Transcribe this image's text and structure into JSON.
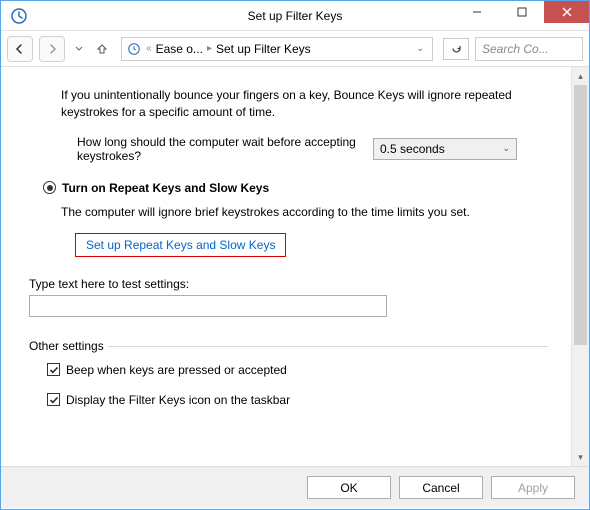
{
  "titlebar": {
    "title": "Set up Filter Keys"
  },
  "nav": {
    "crumb1": "Ease o...",
    "crumb2": "Set up Filter Keys",
    "search_placeholder": "Search Co..."
  },
  "bounce": {
    "desc": "If you unintentionally bounce your fingers on a key, Bounce Keys will ignore repeated keystrokes for a specific amount of time.",
    "question": "How long should the computer wait before accepting keystrokes?",
    "selected": "0.5 seconds"
  },
  "repeat": {
    "radio_label": "Turn on Repeat Keys and Slow Keys",
    "desc": "The computer will ignore brief keystrokes according to the time limits you set.",
    "link": "Set up Repeat Keys and Slow Keys"
  },
  "test": {
    "label": "Type text here to test settings:",
    "value": ""
  },
  "other": {
    "heading": "Other settings",
    "beep": "Beep when keys are pressed or accepted",
    "taskbar": "Display the Filter Keys icon on the taskbar"
  },
  "buttons": {
    "ok": "OK",
    "cancel": "Cancel",
    "apply": "Apply"
  }
}
